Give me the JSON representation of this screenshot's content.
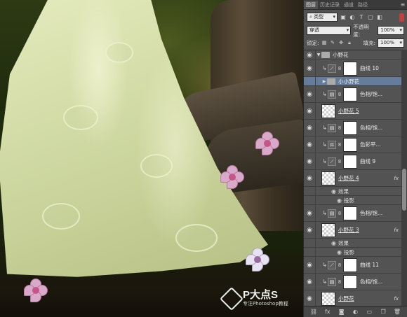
{
  "panel": {
    "tabs": [
      "图层",
      "历史记录",
      "通道",
      "路径"
    ],
    "active_tab": 0,
    "filter_kind": "类型",
    "blend_mode": "穿透",
    "opacity_label": "不透明度:",
    "opacity_value": "100%",
    "lock_label": "锁定:",
    "fill_label": "填充:",
    "fill_value": "100%",
    "accent_selected": "#657c9b",
    "toggle_color": "#c04040"
  },
  "layers": [
    {
      "type": "group",
      "name": "小野花",
      "expanded": true
    },
    {
      "type": "adjust",
      "icon": "curves-icon",
      "name": "曲线 10",
      "clipped": true
    },
    {
      "type": "subgroup",
      "name": "小小野花",
      "selected": true
    },
    {
      "type": "adjust",
      "icon": "hue-icon",
      "name": "色相/饱...",
      "clipped": true
    },
    {
      "type": "pixel",
      "name": "小野花 5"
    },
    {
      "type": "adjust",
      "icon": "hue-icon",
      "name": "色相/饱...",
      "clipped": true
    },
    {
      "type": "adjust",
      "icon": "balance-icon",
      "name": "色彩平...",
      "clipped": true
    },
    {
      "type": "adjust",
      "icon": "curves-icon",
      "name": "曲线 9",
      "clipped": true
    },
    {
      "type": "pixel",
      "name": "小野花 4",
      "fx": "fx",
      "effects_label": "效果",
      "effect": "投影"
    },
    {
      "type": "adjust",
      "icon": "hue-icon",
      "name": "色相/饱...",
      "clipped": true
    },
    {
      "type": "pixel",
      "name": "小野花 3",
      "fx": "fx",
      "effects_label": "效果",
      "effect": "投影"
    },
    {
      "type": "adjust",
      "icon": "curves-icon",
      "name": "曲线 11",
      "clipped": true
    },
    {
      "type": "adjust",
      "icon": "hue-icon",
      "name": "色相/饱...",
      "clipped": true
    },
    {
      "type": "pixel",
      "name": "小野花",
      "fx": "fx"
    }
  ],
  "watermark": {
    "brand": "P大点S",
    "tagline": "专注Photoshop教程"
  }
}
